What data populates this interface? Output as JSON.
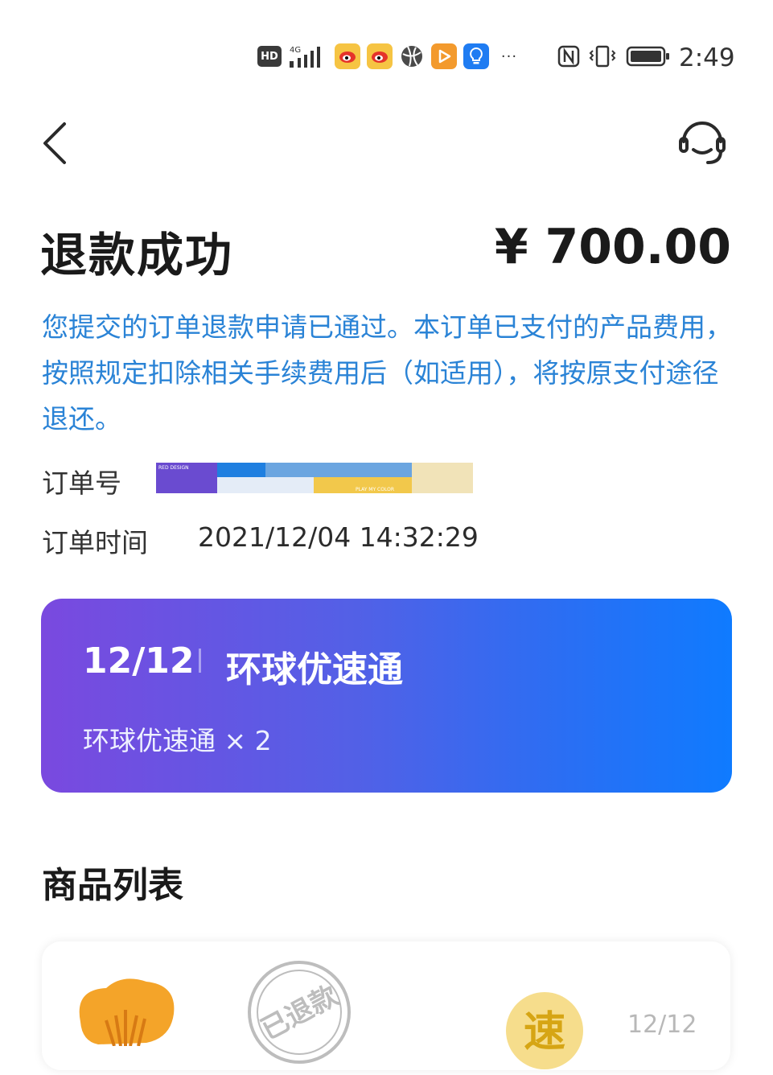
{
  "status_bar": {
    "hd": "HD",
    "net": "4G",
    "more": "···",
    "time": "2:49",
    "icons": [
      "hd-icon",
      "signal-icon",
      "weibo-icon",
      "weibo-icon",
      "ball-icon",
      "video-play-icon",
      "bulb-icon",
      "more-icon",
      "nfc-icon",
      "vibrate-icon",
      "battery-icon"
    ]
  },
  "header": {
    "back_icon": "chevron-left-icon",
    "service_icon": "headset-icon"
  },
  "summary": {
    "title": "退款成功",
    "amount": "¥ 700.00",
    "notice": "您提交的订单退款申请已通过。本订单已支付的产品费用，按照规定扣除相关手续费用后（如适用），将按原支付途径退还。"
  },
  "order": {
    "number_label": "订单号",
    "time_label": "订单时间",
    "time_value": "2021/12/04 14:32:29",
    "redacted_banner_text_1": "RED DESIGN",
    "redacted_banner_text_2": "PLAY MY COLOR"
  },
  "card": {
    "date": "12/12",
    "name": "环球优速通",
    "detail": "环球优速通 × 2",
    "colors": {
      "start": "#7a49df",
      "end": "#0f7bff"
    }
  },
  "products": {
    "section_title": "商品列表",
    "stamp_text": "已退款",
    "badge_char": "速",
    "date": "12/12"
  }
}
